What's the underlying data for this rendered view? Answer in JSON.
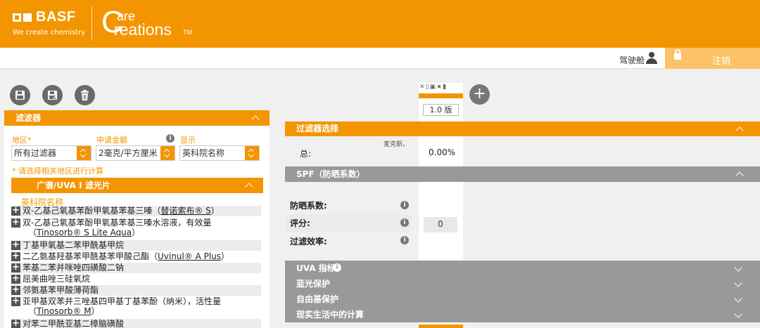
{
  "brand": {
    "basf": "BASF",
    "tagline": "We create chemistry",
    "care_c": "C",
    "care_are": "are",
    "care_reations": "reations",
    "care_mark": "TM"
  },
  "topbar": {
    "cockpit": "驾驶舱",
    "logout": "注销"
  },
  "left": {
    "filter_section": "滤波器",
    "region_label": "地区*",
    "amount_label": "申请金额",
    "display_label": "显示",
    "region_value": "所有过滤器",
    "amount_value": "2毫克/平方厘米",
    "display_value": "英科院名称",
    "note": "* 请选择相关地区进行计算",
    "subsection": "广谱/UVA I 滤光片",
    "column": "英科院名称",
    "rows": [
      {
        "text": "双-乙基己氧基苯酚甲氧基苯基三嗪（",
        "link": "替诺索布® S",
        "after": "）"
      },
      {
        "text": "双-乙基己氧基苯酚甲氧基苯基三嗪水溶液，有效量",
        "line2": "Tinosorb® S Lite Aqua",
        "line2_pre": "（",
        "line2_post": "）"
      },
      {
        "text": "丁基甲氧基二苯甲酰基甲烷"
      },
      {
        "text": "二乙氨基羟基苯甲酰基苯甲酸己酯（",
        "link": "Uvinul® A Plus",
        "after": "）"
      },
      {
        "text": "苯基二苯并咪唑四磺酸二钠"
      },
      {
        "text": "屈美曲唑三硅氧烷"
      },
      {
        "text": "邻氨基苯甲酸薄荷酯"
      },
      {
        "text": "亚甲基双苯并三唑基四甲基丁基苯酚（纳米），活性量",
        "line2": "Tinosorb® M",
        "line2_pre": "（",
        "line2_post": "）"
      },
      {
        "text": "对苯二甲酰亚基二樟脑磺酸"
      }
    ]
  },
  "right": {
    "version": "1.0 版",
    "filter_selection": "过滤器选择",
    "max_note": "麦克斯。",
    "total_label": "总:",
    "total_value": "0.00%",
    "spf_section": "SPF（防晒系数）",
    "spf_label": "防晒系数:",
    "score_label": "评分:",
    "score_value": "0",
    "efficiency_label": "过滤效率:",
    "uva": "UVA 指标",
    "blue": "蓝光保护",
    "radical": "自由基保护",
    "real_life": "现实生活中的计算"
  }
}
